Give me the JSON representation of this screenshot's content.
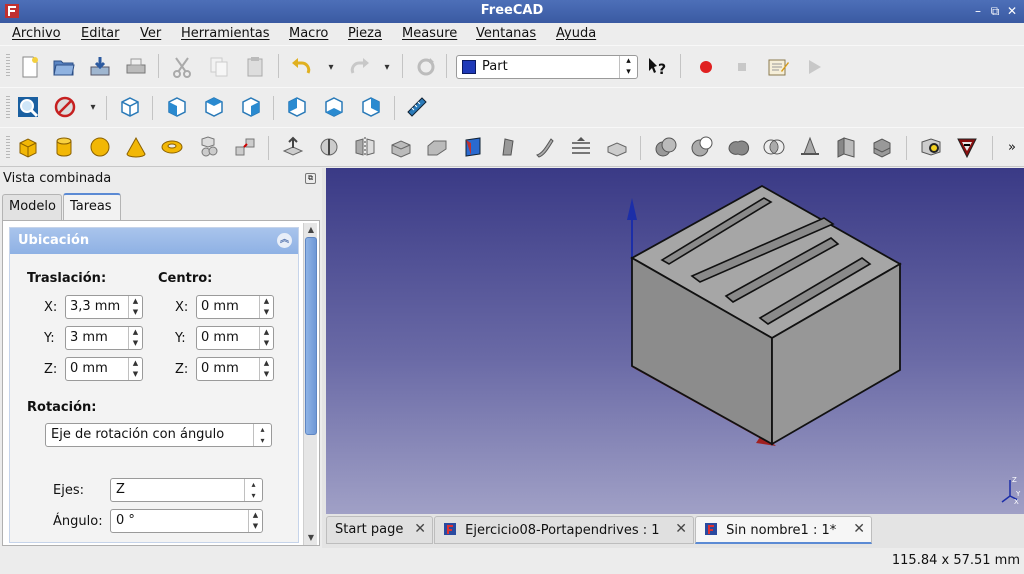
{
  "window": {
    "title": "FreeCAD",
    "controls": [
      "–",
      "⧉",
      "✕"
    ]
  },
  "menu": [
    "Archivo",
    "Editar",
    "Ver",
    "Herramientas",
    "Macro",
    "Pieza",
    "Measure",
    "Ventanas",
    "Ayuda"
  ],
  "toolbar": {
    "workbench": "Part",
    "file_icons": [
      "new-file-icon",
      "open-file-icon",
      "save-icon",
      "print-icon",
      "cut-icon",
      "copy-icon",
      "paste-icon",
      "undo-icon",
      "redo-icon",
      "refresh-icon",
      "whats-this-icon",
      "record-macro-icon",
      "stop-macro-icon",
      "edit-macro-icon",
      "run-macro-icon"
    ],
    "view_icons": [
      "fit-all-icon",
      "draw-style-icon",
      "isometric-view-icon",
      "front-view-icon",
      "top-view-icon",
      "right-view-icon",
      "rear-view-icon",
      "bottom-view-icon",
      "left-view-icon",
      "measure-distance-icon"
    ],
    "part_icons": [
      "box-icon",
      "cylinder-icon",
      "sphere-icon",
      "cone-icon",
      "torus-icon",
      "primitives-icon",
      "shape-builder-icon",
      "extrude-icon",
      "revolve-icon",
      "mirror-icon",
      "fillet-icon",
      "chamfer-icon",
      "make-face-icon",
      "ruled-surface-icon",
      "loft-icon",
      "sweep-icon",
      "section-icon",
      "cross-sections-icon",
      "boolean-icon",
      "cut-icon",
      "fuse-icon",
      "common-icon",
      "section-cut-icon",
      "thickness-icon",
      "offset-icon",
      "check-geometry-icon",
      "defeaturing-icon"
    ],
    "overflow": "»"
  },
  "combo_view": {
    "title": "Vista combinada",
    "tabs": [
      "Modelo",
      "Tareas"
    ],
    "active_tab": "Tareas"
  },
  "placement": {
    "header": "Ubicación",
    "translation_label": "Traslación:",
    "center_label": "Centro:",
    "translation": [
      {
        "axis": "X:",
        "value": "3,3 mm"
      },
      {
        "axis": "Y:",
        "value": "3 mm"
      },
      {
        "axis": "Z:",
        "value": "0 mm"
      }
    ],
    "center": [
      {
        "axis": "X:",
        "value": "0 mm"
      },
      {
        "axis": "Y:",
        "value": "0 mm"
      },
      {
        "axis": "Z:",
        "value": "0 mm"
      }
    ],
    "rotation_label": "Rotación:",
    "rotation_mode": "Eje de rotación con ángulo",
    "axis_label": "Ejes:",
    "axis_value": "Z",
    "angle_label": "Ángulo:",
    "angle_value": "0 °"
  },
  "doc_tabs": [
    {
      "label": "Start page",
      "icon": ""
    },
    {
      "label": "Ejercicio08-Portapendrives : 1",
      "icon": "freecad-document-icon"
    },
    {
      "label": "Sin nombre1 : 1*",
      "icon": "freecad-document-icon",
      "active": true
    }
  ],
  "status": {
    "dimensions": "115.84 x 57.51 mm"
  },
  "colors": {
    "titlebar": "#3f60a8",
    "viewport_top": "#3a3a86",
    "viewport_bottom": "#a0a0c6",
    "solid": "#8e8e8e",
    "accent": "#5b8ad4"
  }
}
